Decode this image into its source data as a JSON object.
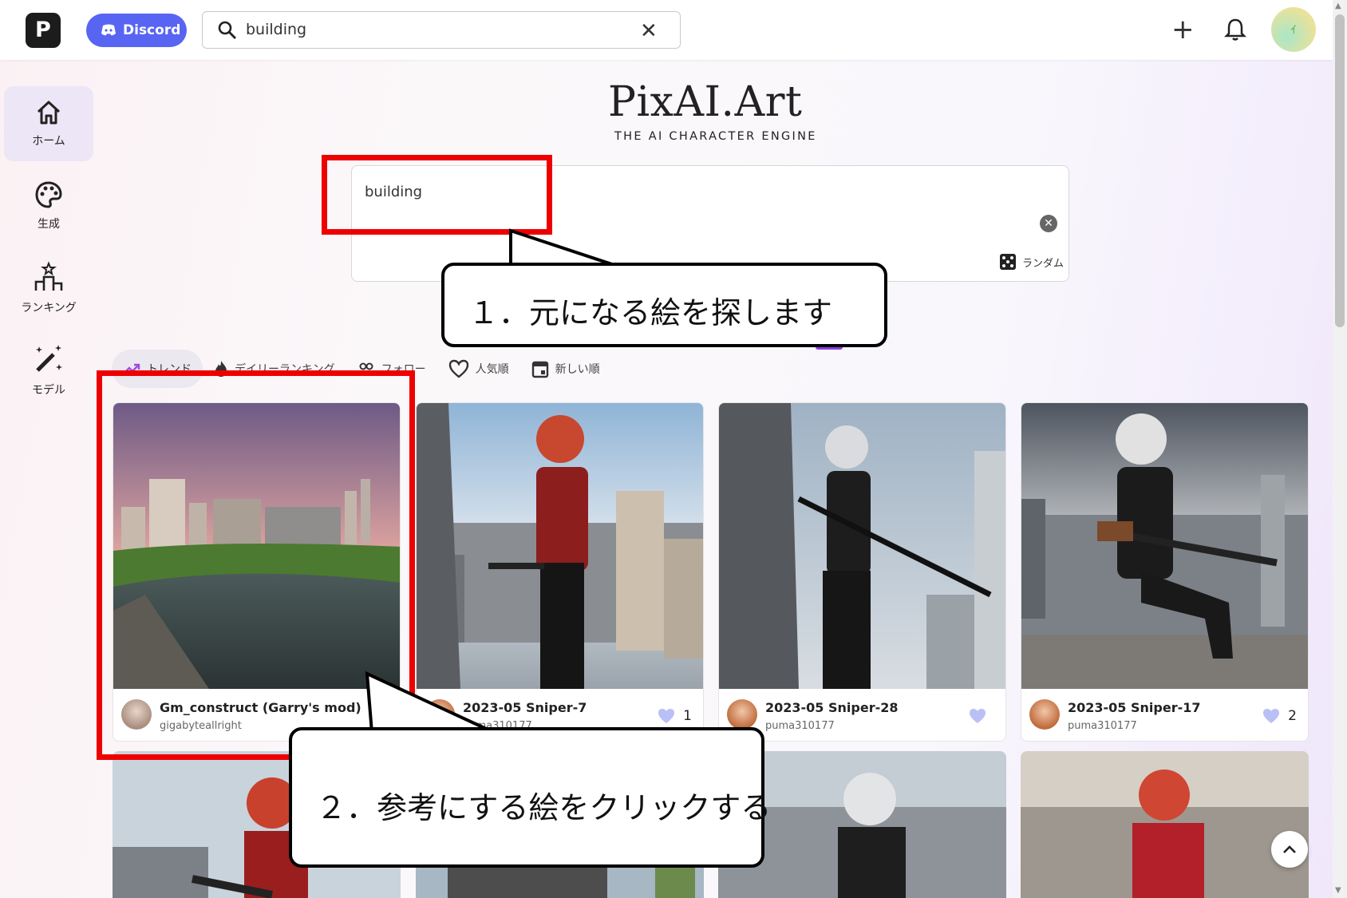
{
  "topbar": {
    "logo_letter": "P",
    "discord_label": "Discord",
    "search_value": "building",
    "clear_icon": "close-icon"
  },
  "sidebar": {
    "items": [
      {
        "label": "ホーム",
        "icon": "home-icon",
        "active": true
      },
      {
        "label": "生成",
        "icon": "palette-icon"
      },
      {
        "label": "ランキング",
        "icon": "ranking-icon"
      },
      {
        "label": "モデル",
        "icon": "magic-wand-icon"
      }
    ]
  },
  "hero": {
    "brand": "PixAI.Art",
    "tagline": "THE AI CHARACTER ENGINE",
    "prompt_value": "building",
    "random_label": "ランダム"
  },
  "tabs": [
    {
      "label": "トレンド",
      "icon": "trending-icon",
      "active": true
    },
    {
      "label": "デイリーランキング",
      "icon": "fire-icon"
    },
    {
      "label": "フォロー",
      "icon": "people-icon"
    },
    {
      "label": "人気順",
      "icon": "heart-icon"
    },
    {
      "label": "新しい順",
      "icon": "calendar-icon"
    }
  ],
  "cards": [
    {
      "title": "Gm_construct (Garry's mod)",
      "user": "gigabyteallright",
      "likes": ""
    },
    {
      "title": "2023-05 Sniper-7",
      "user": "puma310177",
      "likes": "1"
    },
    {
      "title": "2023-05 Sniper-28",
      "user": "puma310177",
      "likes": ""
    },
    {
      "title": "2023-05 Sniper-17",
      "user": "puma310177",
      "likes": "2"
    }
  ],
  "annotations": {
    "step1": "１．元になる絵を探します",
    "step2": "２．参考にする絵をクリックする"
  },
  "colors": {
    "accent": "#5865f2",
    "highlight": "#ee0000",
    "like": "#b9c0f5"
  }
}
